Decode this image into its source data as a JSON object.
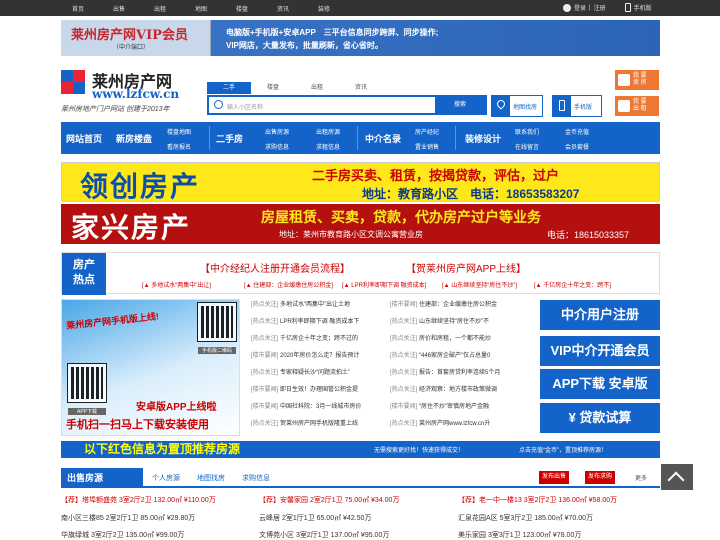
{
  "topbar": {
    "nav": [
      "首页",
      "出售",
      "出租",
      "地图",
      "楼盘",
      "资讯",
      "装修"
    ],
    "login": "登录",
    "sep": "|",
    "register": "注册",
    "mobile": "手机版"
  },
  "banner1": {
    "vip_title": "莱州房产网VIP会员",
    "vip_sub": "（中介端口）",
    "line1": "电脑版+手机版+安卓APP　三平台信息同步跨屏、同步操作;",
    "line2": "VIP网店，大量发布，批量刷新，省心省时。"
  },
  "logo": {
    "cn": "莱州房产网",
    "url": "www.lzfcw.cn",
    "slogan": "莱州房地产门户网站  创建于2013年"
  },
  "search": {
    "tabs": [
      "二手",
      "楼盘",
      "出租",
      "资讯"
    ],
    "placeholder": "输入小区名称",
    "button": "搜索"
  },
  "tools": {
    "map": "地图找房",
    "mobile": "手机版"
  },
  "side": {
    "sell": "我 要\n卖 房",
    "rent": "我 要\n出 租"
  },
  "mainnav": {
    "home": "网站首页",
    "newhouse": "新房楼盘",
    "map": "楼盘地图",
    "sign": "看房报名",
    "secondhand": "二手房",
    "resale": "出售房源",
    "buy": "求购信息",
    "rent": "出租房源",
    "rentwant": "求租信息",
    "agency": "中介名录",
    "esf_eval": "房产经纪",
    "yeshou": "置业销售",
    "decor": "装修设计",
    "contact": "联系我们",
    "message": "在线留言",
    "vip": "金币充值",
    "pkg": "会员套餐"
  },
  "ad1": {
    "big": "领创房产",
    "l1": "二手房买卖、租赁，按揭贷款，评估，过户",
    "l2": "地址：教育路小区　电话：18653583207"
  },
  "ad2": {
    "big": "家兴房产",
    "l1": "房屋租赁、买卖，贷款，代办房产过户等业务",
    "l2": "地址：莱州市教育路小区文调公寓营业房",
    "l3": "电话：18615033357"
  },
  "hot": {
    "tag": "房产\n热点",
    "h1": "【中介经纪人注册开通会员流程】",
    "h2": "【贺莱州房产网APP上线】",
    "r1": "[▲ 多地试水“两集中”出让]",
    "r2": "[▲ 住建部：企业缓缴住房公积金]",
    "r3": "[▲ LPR利率即期下调 融资成本]",
    "r4": "[▲ 山东继续坚持“房住不炒”]",
    "r5": "[▲ 千亿房企十年之变：跨不]"
  },
  "mobile": {
    "title": "莱州房产网手机版上线!",
    "qr1": "手机版二维码",
    "qr2": "APP下载",
    "b1": "安卓版APP上线啦",
    "b2": "手机扫一扫马上下载安装使用"
  },
  "news": {
    "left": [
      [
        "[热点关注]",
        "多地试水“两集中”出让土地"
      ],
      [
        "[热点关注]",
        "LPR利率即期下调 融资成本下"
      ],
      [
        "[热点关注]",
        "千亿房企十年之变；跨不过的"
      ],
      [
        "[楼市要闻]",
        "2020年房价怎么走？报告预计"
      ],
      [
        "[热点关注]",
        "专家释疑长沙“问题流拍土”"
      ],
      [
        "[楼市要闻]",
        "即日生效！办理国管公积金提"
      ],
      [
        "[楼市要闻]",
        "中国社科院：3月一线城市房价"
      ],
      [
        "[热点关注]",
        "贺莱州房产网手机版隆重上线"
      ]
    ],
    "right": [
      [
        "[楼市要闻]",
        "住建部：企业缓缴住房公积金"
      ],
      [
        "[热点关注]",
        "山东继续坚持“房住不炒”不"
      ],
      [
        "[热点关注]",
        "房价和房租，一个都不能炒"
      ],
      [
        "[热点关注]",
        "“446家房企破产”仅占总量0"
      ],
      [
        "[热点关注]",
        "报告：首套房贷利率连续5个月"
      ],
      [
        "[热点关注]",
        "经济观察：地方楼市政策微调"
      ],
      [
        "[楼市要闻]",
        "“房住不炒”审慎房地产金融"
      ],
      [
        "[热点关注]",
        "莱州房产网www.lzfcw.cn升"
      ]
    ]
  },
  "rightbtns": [
    "中介用户注册",
    "VIP中介开通会员",
    "APP下载 安卓版",
    "¥ 贷款试算"
  ],
  "redbar": {
    "t": "以下红色信息为置顶推荐房源",
    "s1": "无需搜索更好找！快速获得成交！",
    "s2": "点击充值“金币”，置顶推荐房源！"
  },
  "sale": {
    "title": "出售房源",
    "tabs": [
      "个人房源",
      "地图找房",
      "求购信息"
    ],
    "btn1": "发布出售",
    "btn2": "发布求购",
    "more": "更多"
  },
  "listings": [
    [
      "【荐】塔埠额盛苑 3室2厅2卫 132.00㎡ ¥110.00万",
      "【荐】安馨家园 2室2厅1卫 75.00㎡ ¥34.00万",
      "【荐】老一中一楼13 3室2厅2卫 136.00㎡ ¥58.00万"
    ],
    [
      "南小区三楼85 2室2厅1卫 85.00㎡ ¥29.80万",
      "云峰居 2室1厅1卫 65.00㎡ ¥42.50万",
      "汇泉花园A区 5室3厅2卫 185.00㎡ ¥70.00万"
    ],
    [
      "华旗绿城 3室2厅2卫 135.00㎡ ¥99.00万",
      "文博苑小区 3室2厅1卫 137.00㎡ ¥95.00万",
      "美乐家园 3室3厅1卫 123.00㎡ ¥78.00万"
    ]
  ],
  "colors": {
    "primary": "#1463c8",
    "accent": "#c00"
  }
}
